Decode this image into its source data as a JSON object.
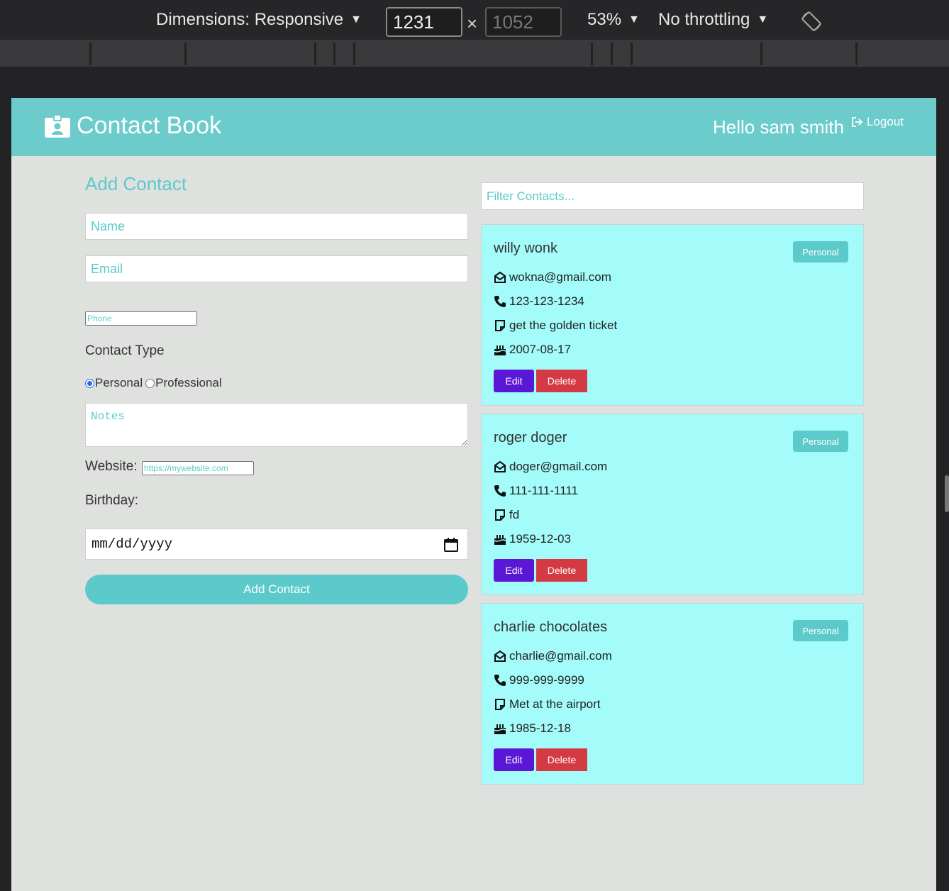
{
  "devtools": {
    "dimensions_label": "Dimensions: Responsive",
    "width": "1231",
    "height": "1052",
    "times": "×",
    "zoom": "53%",
    "throttling": "No throttling"
  },
  "navbar": {
    "brand": "Contact Book",
    "greeting": "Hello sam smith",
    "logout": "Logout"
  },
  "form": {
    "title": "Add Contact",
    "name_placeholder": "Name",
    "email_placeholder": "Email",
    "phone_placeholder": "Phone",
    "contact_type_label": "Contact Type",
    "type_options": [
      "Personal",
      "Professional"
    ],
    "selected_type": "Personal",
    "notes_placeholder": "Notes",
    "website_label": "Website:",
    "website_placeholder": "https://mywebsite.com",
    "birthday_label": "Birthday:",
    "date_placeholder": "mm/dd/yyyy",
    "submit": "Add Contact"
  },
  "filter": {
    "placeholder": "Filter Contacts..."
  },
  "contacts": [
    {
      "name": "willy wonk",
      "type": "Personal",
      "email": "wokna@gmail.com",
      "phone": "123-123-1234",
      "notes": "get the golden ticket",
      "birthday": "2007-08-17",
      "edit": "Edit",
      "delete": "Delete"
    },
    {
      "name": "roger doger",
      "type": "Personal",
      "email": "doger@gmail.com",
      "phone": "111-111-1111",
      "notes": "fd",
      "birthday": "1959-12-03",
      "edit": "Edit",
      "delete": "Delete"
    },
    {
      "name": "charlie chocolates",
      "type": "Personal",
      "email": "charlie@gmail.com",
      "phone": "999-999-9999",
      "notes": "Met at the airport",
      "birthday": "1985-12-18",
      "edit": "Edit",
      "delete": "Delete"
    }
  ],
  "colors": {
    "accent": "#6ccccc",
    "card_bg": "#a3fcfa",
    "edit": "#5b17d6",
    "delete": "#d43a44"
  }
}
